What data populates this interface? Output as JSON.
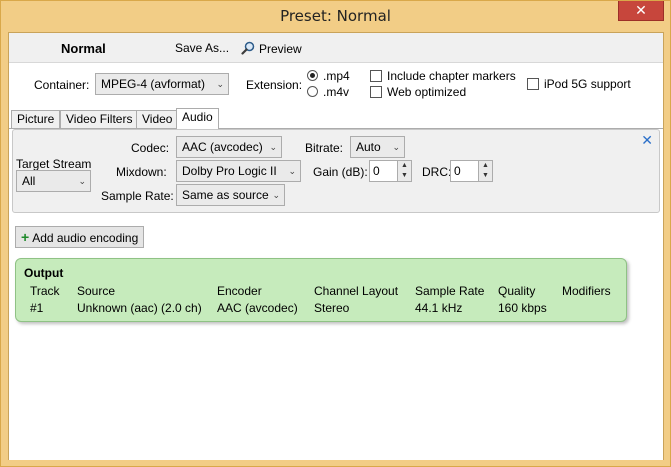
{
  "window": {
    "title": "Preset: Normal",
    "close_glyph": "✕"
  },
  "toolbar": {
    "preset_name": "Normal",
    "save_as": "Save As...",
    "preview": "Preview"
  },
  "container": {
    "label": "Container:",
    "value": "MPEG-4 (avformat)"
  },
  "extension": {
    "label": "Extension:",
    "options": [
      ".mp4",
      ".m4v"
    ],
    "selected": ".mp4"
  },
  "checkboxes": {
    "chapter_markers": "Include chapter markers",
    "web_optimized": "Web optimized",
    "ipod": "iPod 5G support"
  },
  "tabs": [
    "Picture",
    "Video Filters",
    "Video",
    "Audio"
  ],
  "active_tab": "Audio",
  "audio": {
    "target_stream_label": "Target Stream",
    "target_stream_value": "All",
    "codec_label": "Codec:",
    "codec_value": "AAC (avcodec)",
    "bitrate_label": "Bitrate:",
    "bitrate_value": "Auto",
    "mixdown_label": "Mixdown:",
    "mixdown_value": "Dolby Pro Logic II",
    "gain_label": "Gain (dB):",
    "gain_value": "0",
    "drc_label": "DRC:",
    "drc_value": "0",
    "samplerate_label": "Sample Rate:",
    "samplerate_value": "Same as source",
    "remove_glyph": "✕"
  },
  "add_audio": {
    "label": "Add audio encoding"
  },
  "output": {
    "title": "Output",
    "headers": [
      "Track",
      "Source",
      "Encoder",
      "Channel Layout",
      "Sample Rate",
      "Quality",
      "Modifiers"
    ],
    "row": [
      "#1",
      "Unknown (aac) (2.0 ch)",
      "AAC (avcodec)",
      "Stereo",
      "44.1 kHz",
      "160 kbps",
      ""
    ]
  },
  "colors": {
    "window_frame": "#f2cd86",
    "close": "#c7463c",
    "output_bg": "#c6ebbc",
    "plus": "#1e8a2a"
  }
}
